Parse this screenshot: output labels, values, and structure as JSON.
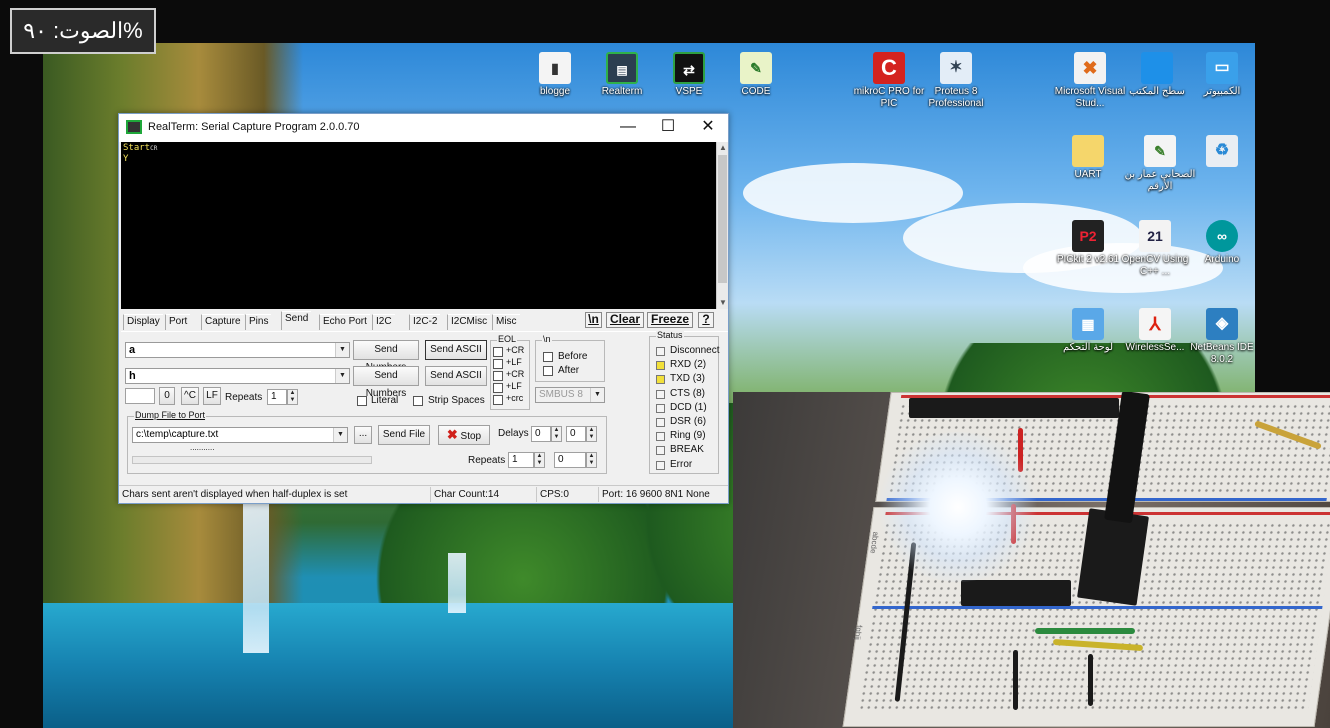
{
  "volume_overlay": "%الصوت: ٩٠",
  "desktop_icons": [
    {
      "label": "blogge",
      "icon": "blog-file-icon"
    },
    {
      "label": "Realterm",
      "icon": "realterm-icon"
    },
    {
      "label": "VSPE",
      "icon": "vspe-icon"
    },
    {
      "label": "CODE",
      "icon": "code-notepad-icon"
    },
    {
      "label": "mikroC PRO for PIC",
      "icon": "mikroc-icon"
    },
    {
      "label": "Proteus 8 Professional",
      "icon": "proteus-icon"
    },
    {
      "label": "Microsoft Visual Stud...",
      "icon": "visual-studio-icon"
    },
    {
      "label": "سطح المكتب",
      "icon": "desktop-folder-icon"
    },
    {
      "label": "الكمبيوتر",
      "icon": "computer-icon"
    },
    {
      "label": "UART",
      "icon": "folder-icon"
    },
    {
      "label": "الصحابي عمار بن الأرقم",
      "icon": "text-file-icon"
    },
    {
      "label": "",
      "icon": "recycle-bin-icon"
    },
    {
      "label": "PICkit 2 v2.61",
      "icon": "pickit2-icon"
    },
    {
      "label": "OpenCV Using C++ ...",
      "icon": "opencv-icon"
    },
    {
      "label": "Arduino",
      "icon": "arduino-icon"
    },
    {
      "label": "لوحة التحكم",
      "icon": "control-panel-icon"
    },
    {
      "label": "WirelessSe...",
      "icon": "pdf-icon"
    },
    {
      "label": "NetBeans IDE 8.0.2",
      "icon": "netbeans-icon"
    }
  ],
  "realterm": {
    "title": "RealTerm: Serial Capture Program 2.0.0.70",
    "window_buttons": {
      "minimize": "—",
      "maximize": "☐",
      "close": "✕"
    },
    "terminal_lines": [
      "Start",
      "Y"
    ],
    "terminal_cr_marker": "CR",
    "tabs": [
      "Display",
      "Port",
      "Capture",
      "Pins",
      "Send",
      "Echo Port",
      "I2C",
      "I2C-2",
      "I2CMisc",
      "Misc"
    ],
    "active_tab": "Send",
    "toolbar_buttons": {
      "newline": "\\n",
      "clear": "Clear",
      "freeze": "Freeze",
      "help": "?"
    },
    "send": {
      "line1_value": "a",
      "line2_value": "h",
      "send_numbers_label": "Send Numbers",
      "send_ascii_label": "Send ASCII",
      "small_field_value": "",
      "zero_button": "0",
      "ctrl_c_button": "^C",
      "lf_button": "LF",
      "repeats_label": "Repeats",
      "repeats_value": "1",
      "literal_label": "Literal",
      "strip_spaces_label": "Strip Spaces",
      "eol_group": "EOL",
      "eol_options": [
        "+CR",
        "+LF",
        "+CR",
        "+LF",
        "+crc"
      ],
      "n_group": "\\n",
      "before_label": "Before",
      "after_label": "After",
      "smbus_value": "SMBUS 8",
      "dump_group": "Dump File to Port",
      "dump_file_value": "c:\\temp\\capture.txt",
      "browse_label": "...",
      "send_file_label": "Send File",
      "stop_label": "Stop",
      "delays_label": "Delays",
      "delay1": "0",
      "delay2": "0",
      "dump_repeats_label": "Repeats",
      "dump_repeats1": "1",
      "dump_repeats2": "0",
      "progress_text": "..........."
    },
    "status_group": "Status",
    "status_items": [
      {
        "label": "Disconnect",
        "on": false
      },
      {
        "label": "RXD (2)",
        "on": true
      },
      {
        "label": "TXD (3)",
        "on": true
      },
      {
        "label": "CTS (8)",
        "on": false
      },
      {
        "label": "DCD (1)",
        "on": false
      },
      {
        "label": "DSR (6)",
        "on": false
      },
      {
        "label": "Ring (9)",
        "on": false
      },
      {
        "label": "BREAK",
        "on": false
      },
      {
        "label": "Error",
        "on": false
      }
    ],
    "statusbar": {
      "message": "Chars sent aren't displayed when half-duplex is set",
      "char_count": "Char Count:14",
      "cps": "CPS:0",
      "port": "Port: 16 9600 8N1 None"
    },
    "led_color": "#f2e03a"
  },
  "breadboard_labels": {
    "abcde": "abcde",
    "fghij": "fghij"
  }
}
